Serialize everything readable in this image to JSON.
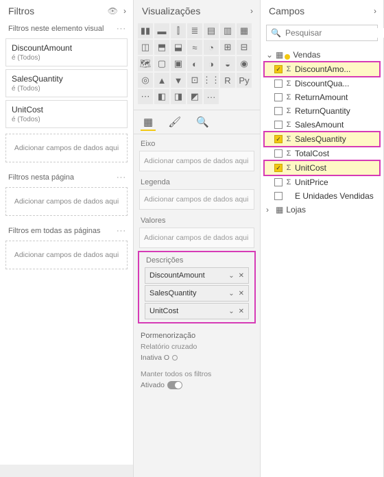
{
  "filters": {
    "title": "Filtros",
    "section_visual": "Filtros neste elemento visual",
    "cards": [
      {
        "name": "DiscountAmount",
        "sub": "é (Todos)"
      },
      {
        "name": "SalesQuantity",
        "sub": "é (Todos)"
      },
      {
        "name": "UnitCost",
        "sub": "é (Todos)"
      }
    ],
    "add_fields": "Adicionar campos de dados aqui",
    "section_page": "Filtros nesta página",
    "section_all": "Filtros em todas as páginas"
  },
  "viz": {
    "title": "Visualizações",
    "axis": "Eixo",
    "legend": "Legenda",
    "values": "Valores",
    "tooltips": "Descrições",
    "add_fields": "Adicionar campos de dados aqui",
    "tooltip_items": [
      "DiscountAmount",
      "SalesQuantity",
      "UnitCost"
    ],
    "drill": "Pormenorização",
    "cross": "Relatório cruzado",
    "inactive": "Inativa O",
    "keep": "Manter todos os filtros",
    "on": "Ativado"
  },
  "fields": {
    "title": "Campos",
    "search_placeholder": "Pesquisar",
    "tables": [
      {
        "name": "Vendas",
        "expanded": true,
        "items": [
          {
            "name": "DiscountAmo...",
            "checked": true,
            "sigma": true,
            "highlighted": true
          },
          {
            "name": "DiscountQua...",
            "checked": false,
            "sigma": true
          },
          {
            "name": "ReturnAmount",
            "checked": false,
            "sigma": true
          },
          {
            "name": "ReturnQuantity",
            "checked": false,
            "sigma": true
          },
          {
            "name": "SalesAmount",
            "checked": false,
            "sigma": true
          },
          {
            "name": "SalesQuantity",
            "checked": true,
            "sigma": true,
            "highlighted": true
          },
          {
            "name": "TotalCost",
            "checked": false,
            "sigma": true
          },
          {
            "name": "UnitCost",
            "checked": true,
            "sigma": true,
            "highlighted": true
          },
          {
            "name": "UnitPrice",
            "checked": false,
            "sigma": true
          },
          {
            "name": "E Unidades Vendidas",
            "checked": false,
            "sigma": false
          }
        ]
      },
      {
        "name": "Lojas",
        "expanded": false,
        "items": []
      }
    ]
  }
}
